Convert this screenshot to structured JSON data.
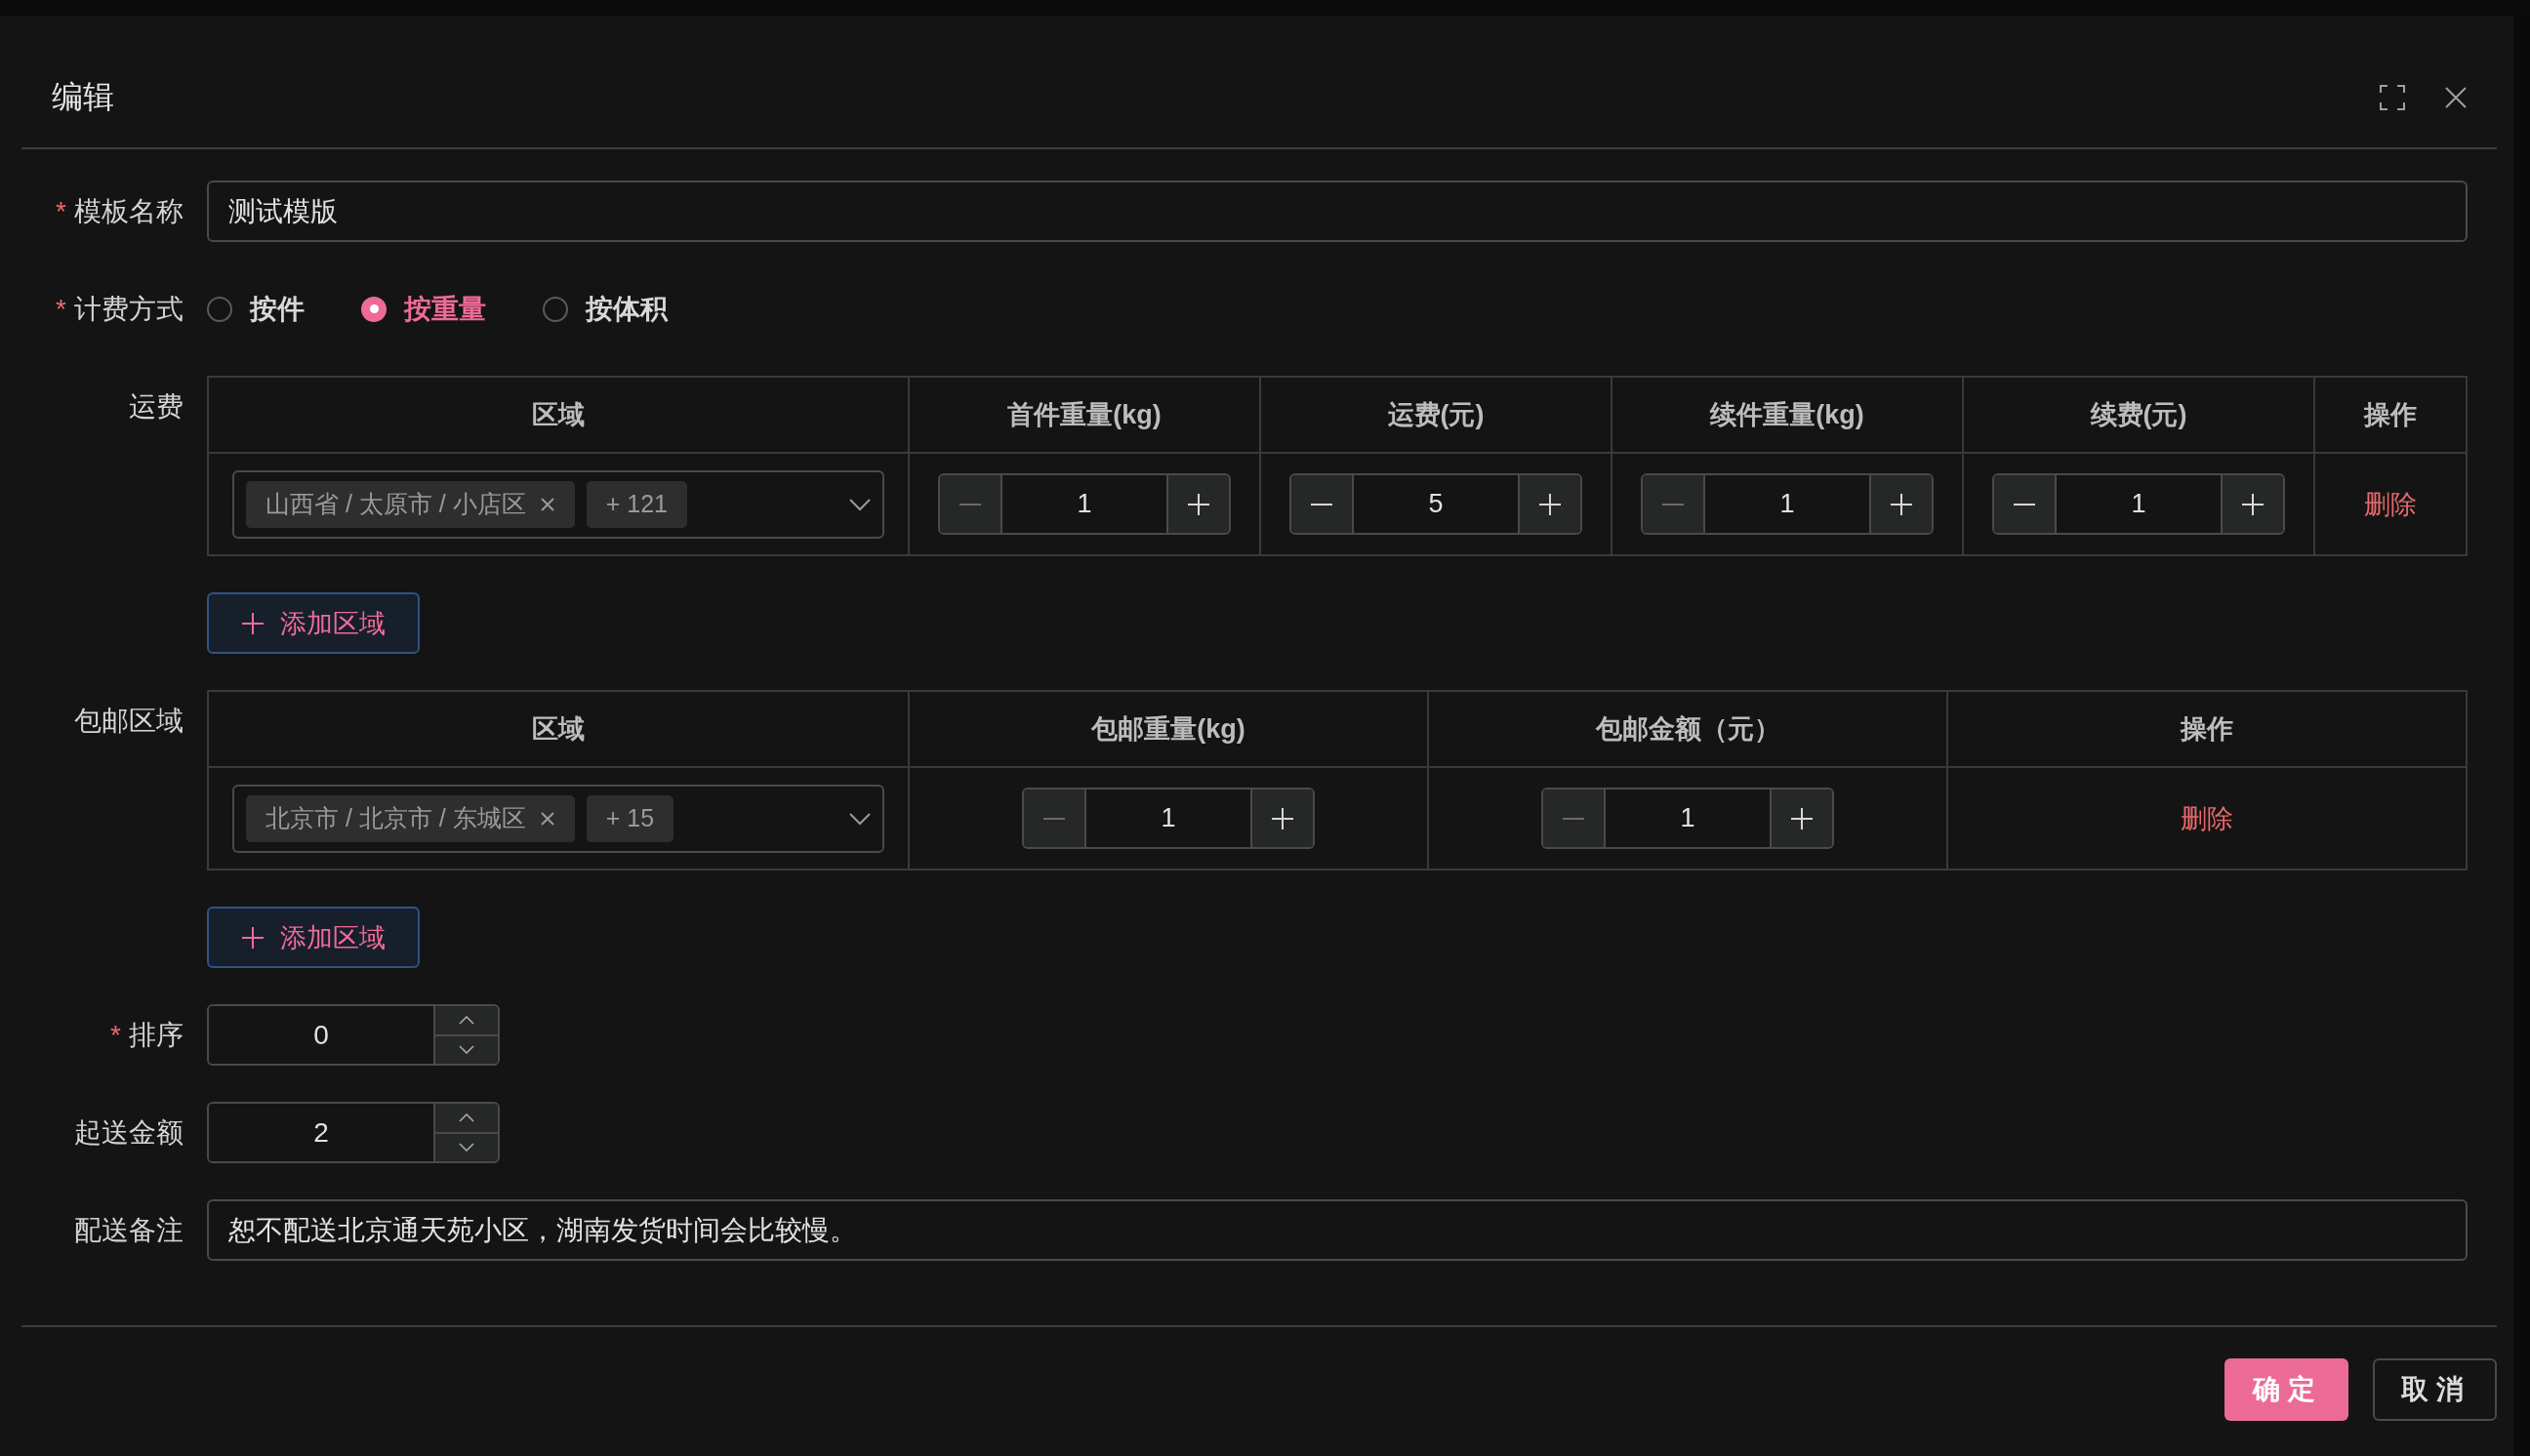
{
  "dialog_title": "编辑",
  "template_name": {
    "required_mark": "*",
    "label": "模板名称",
    "value": "测试模版"
  },
  "billing": {
    "required_mark": "*",
    "label": "计费方式",
    "options": [
      {
        "label": "按件",
        "selected": false
      },
      {
        "label": "按重量",
        "selected": true
      },
      {
        "label": "按体积",
        "selected": false
      }
    ]
  },
  "shipping": {
    "label": "运费",
    "columns": [
      "区域",
      "首件重量(kg)",
      "运费(元)",
      "续件重量(kg)",
      "续费(元)",
      "操作"
    ],
    "rows": [
      {
        "tags": [
          {
            "text": "山西省 / 太原市 / 小店区",
            "closable": true
          },
          {
            "text": "+ 121",
            "closable": false
          }
        ],
        "steppers": [
          {
            "value": "1",
            "minus_disabled": true
          },
          {
            "value": "5",
            "minus_disabled": false
          },
          {
            "value": "1",
            "minus_disabled": true
          },
          {
            "value": "1",
            "minus_disabled": false
          }
        ],
        "action": "删除"
      }
    ],
    "add_button": "添加区域"
  },
  "free_shipping": {
    "label": "包邮区域",
    "columns": [
      "区域",
      "包邮重量(kg)",
      "包邮金额（元）",
      "操作"
    ],
    "rows": [
      {
        "tags": [
          {
            "text": "北京市 / 北京市 / 东城区",
            "closable": true
          },
          {
            "text": "+ 15",
            "closable": false
          }
        ],
        "steppers": [
          {
            "value": "1",
            "minus_disabled": true
          },
          {
            "value": "1",
            "minus_disabled": true
          }
        ],
        "action": "删除"
      }
    ],
    "add_button": "添加区域"
  },
  "sort": {
    "required_mark": "*",
    "label": "排序",
    "value": "0"
  },
  "min_amount": {
    "label": "起送金额",
    "value": "2"
  },
  "note": {
    "label": "配送备注",
    "value": "恕不配送北京通天苑小区，湖南发货时间会比较慢。"
  },
  "buttons": [
    {
      "label": "确定",
      "kind": "primary"
    },
    {
      "label": "取消",
      "kind": "default"
    }
  ]
}
